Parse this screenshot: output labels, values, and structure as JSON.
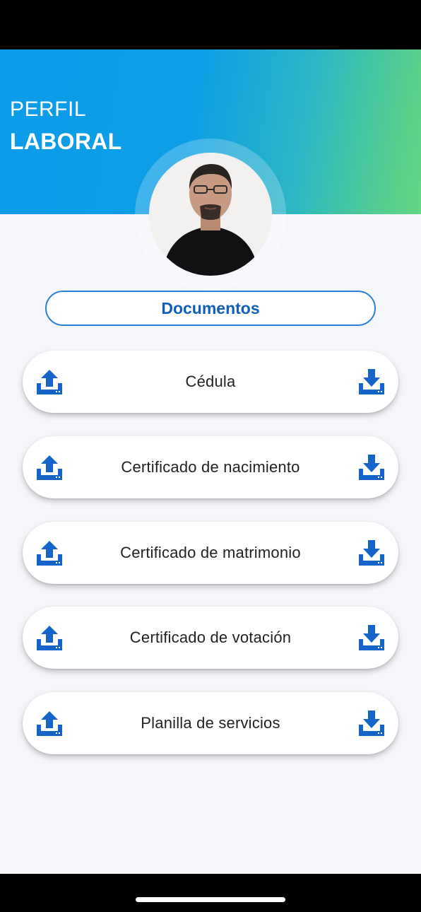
{
  "header": {
    "title_line1": "PERFIL",
    "title_line2": "LABORAL",
    "gradient_start": "#0c9be8",
    "gradient_end": "#63d882"
  },
  "profile": {
    "avatar_icon": "profile-photo"
  },
  "documents_section": {
    "label": "Documentos",
    "accent_color": "#0f5fb8"
  },
  "documents": [
    {
      "label": "Cédula",
      "upload_icon": "upload-icon",
      "download_icon": "download-icon"
    },
    {
      "label": "Certificado de nacimiento",
      "upload_icon": "upload-icon",
      "download_icon": "download-icon"
    },
    {
      "label": "Certificado de matrimonio",
      "upload_icon": "upload-icon",
      "download_icon": "download-icon"
    },
    {
      "label": "Certificado de votación",
      "upload_icon": "upload-icon",
      "download_icon": "download-icon"
    },
    {
      "label": "Planilla de servicios",
      "upload_icon": "upload-icon",
      "download_icon": "download-icon"
    }
  ],
  "icon_color": "#1565c8"
}
